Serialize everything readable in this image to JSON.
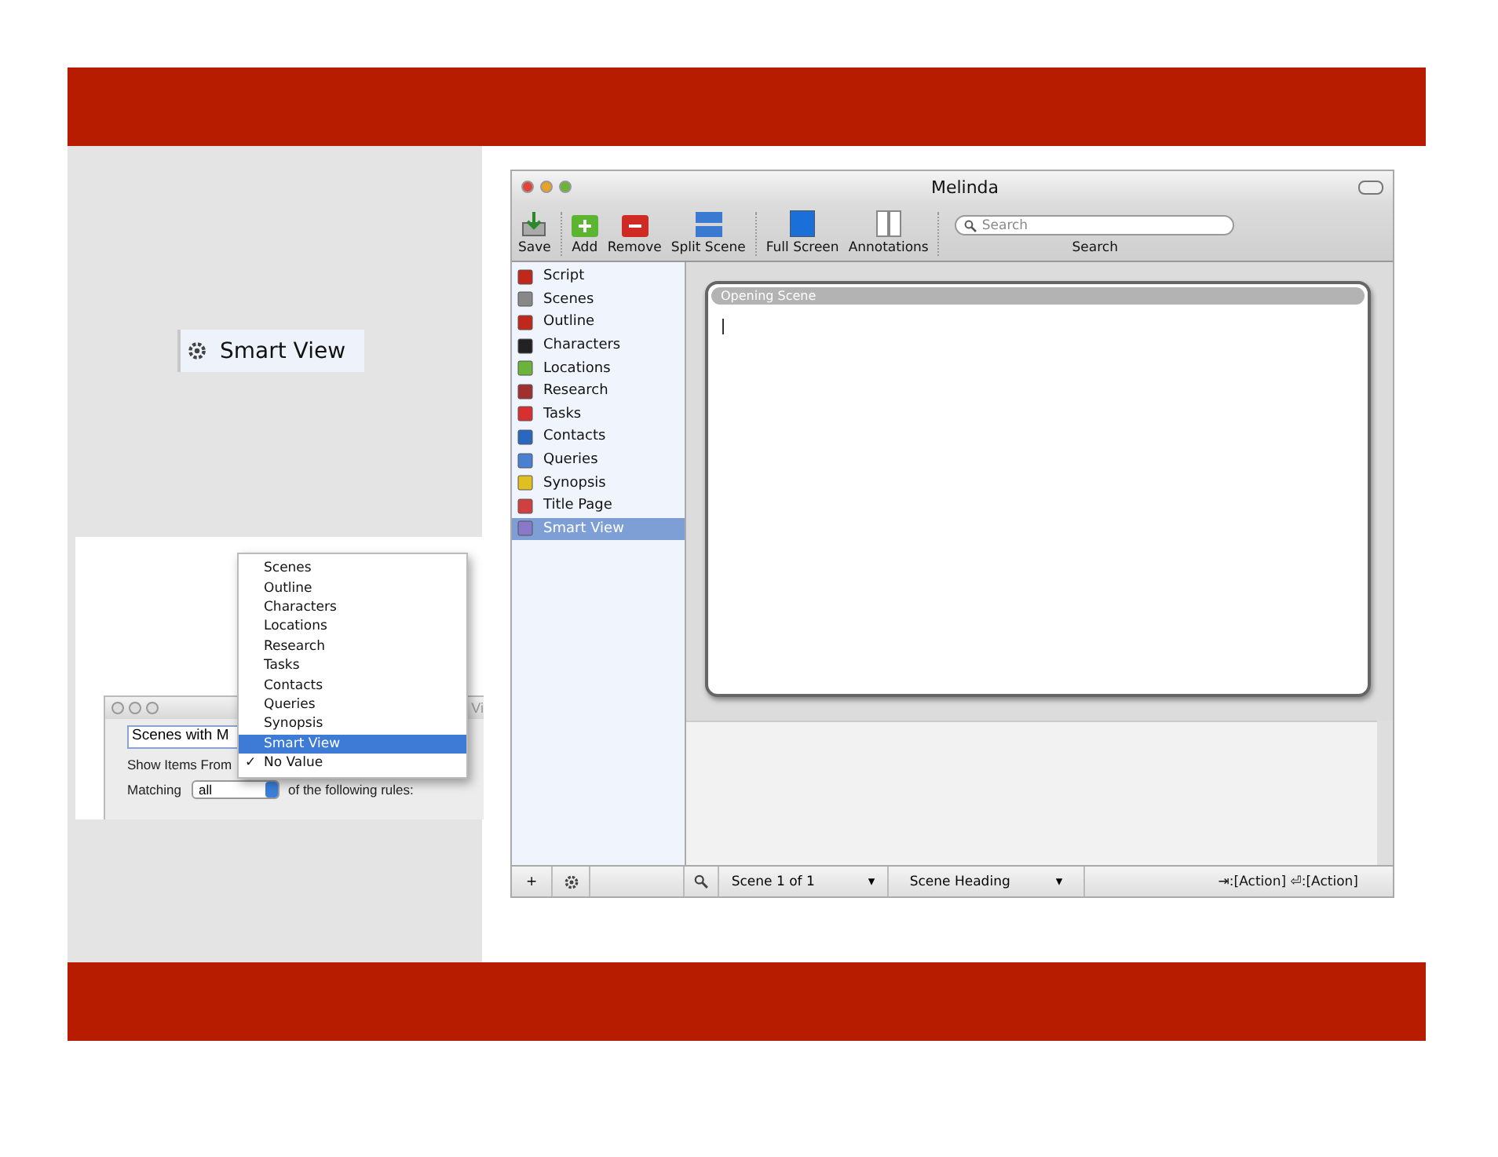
{
  "feature_chip": {
    "label": "Smart View"
  },
  "dialog": {
    "title": "Vi",
    "name_value": "Scenes with M",
    "show_label": "Show Items From",
    "matching_label": "Matching",
    "matching_value": "all",
    "rules_text": "of the following rules:"
  },
  "popup_menu": {
    "items": [
      {
        "label": "Scenes",
        "selected": false,
        "checked": false
      },
      {
        "label": "Outline",
        "selected": false,
        "checked": false
      },
      {
        "label": "Characters",
        "selected": false,
        "checked": false
      },
      {
        "label": "Locations",
        "selected": false,
        "checked": false
      },
      {
        "label": "Research",
        "selected": false,
        "checked": false
      },
      {
        "label": "Tasks",
        "selected": false,
        "checked": false
      },
      {
        "label": "Contacts",
        "selected": false,
        "checked": false
      },
      {
        "label": "Queries",
        "selected": false,
        "checked": false
      },
      {
        "label": "Synopsis",
        "selected": false,
        "checked": false
      },
      {
        "label": "Smart View",
        "selected": true,
        "checked": false
      },
      {
        "label": "No Value",
        "selected": false,
        "checked": true
      }
    ],
    "check_mark": "✓"
  },
  "window": {
    "title": "Melinda"
  },
  "toolbar": {
    "buttons": [
      {
        "kind": "save",
        "label": "Save"
      },
      {
        "kind": "add",
        "label": "Add"
      },
      {
        "kind": "remove",
        "label": "Remove"
      },
      {
        "kind": "split",
        "label": "Split Scene"
      },
      {
        "kind": "fullscreen",
        "label": "Full Screen"
      },
      {
        "kind": "annotations",
        "label": "Annotations"
      }
    ],
    "search": {
      "placeholder": "Search",
      "label": "Search"
    }
  },
  "sidebar": {
    "items": [
      {
        "label": "Script",
        "selected": false
      },
      {
        "label": "Scenes",
        "selected": false
      },
      {
        "label": "Outline",
        "selected": false
      },
      {
        "label": "Characters",
        "selected": false
      },
      {
        "label": "Locations",
        "selected": false
      },
      {
        "label": "Research",
        "selected": false
      },
      {
        "label": "Tasks",
        "selected": false
      },
      {
        "label": "Contacts",
        "selected": false
      },
      {
        "label": "Queries",
        "selected": false
      },
      {
        "label": "Synopsis",
        "selected": false
      },
      {
        "label": "Title Page",
        "selected": false
      },
      {
        "label": "Smart View",
        "selected": true
      }
    ]
  },
  "scene_card": {
    "heading": "Opening Scene"
  },
  "status_bar": {
    "add": "+",
    "scene_count": "Scene 1 of 1",
    "scene_arrow": "▾",
    "element_arrow": "▾",
    "element": "Scene Heading",
    "tab_hint": "⇥:[Action]",
    "return_hint": "⏎:[Action]"
  }
}
